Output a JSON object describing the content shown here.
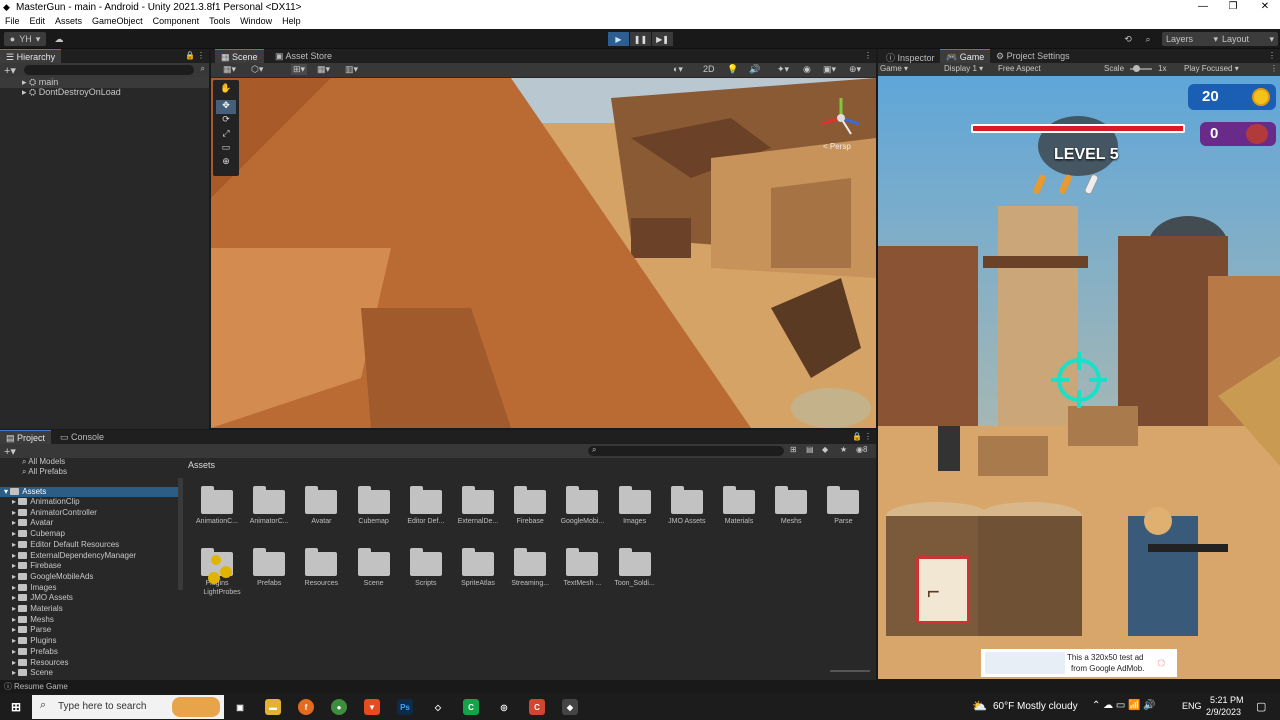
{
  "window": {
    "title": "MasterGun - main - Android - Unity 2021.3.8f1 Personal <DX11>",
    "min_glyph": "—",
    "max_glyph": "❐",
    "close_glyph": "✕"
  },
  "menu": [
    "File",
    "Edit",
    "Assets",
    "GameObject",
    "Component",
    "Tools",
    "Window",
    "Help"
  ],
  "toolbar": {
    "account": "YH",
    "layers": "Layers",
    "layout": "Layout",
    "play_glyph": "▶",
    "pause_glyph": "❚❚",
    "step_glyph": "▶❚"
  },
  "hierarchy": {
    "tab": "Hierarchy",
    "items": [
      "main",
      "DontDestroyOnLoad"
    ]
  },
  "scene": {
    "tabs": [
      "Scene",
      "Asset Store"
    ],
    "mode_2d": "2D",
    "persp": "< Persp"
  },
  "game": {
    "tabs": [
      "Inspector",
      "Game",
      "Project Settings"
    ],
    "display_mode": "Game",
    "display": "Display 1",
    "aspect": "Free Aspect",
    "scale_label": "Scale",
    "scale_value": "1x",
    "play_focused": "Play Focused",
    "hud": {
      "coins": "20",
      "kills": "0",
      "level": "LEVEL 5",
      "health_fraction": 1.0
    },
    "ad": {
      "line1": "This a 320x50 test ad",
      "line2": "from Google AdMob."
    }
  },
  "project": {
    "tabs": [
      "Project",
      "Console"
    ],
    "favorites": [
      "All Models",
      "All Prefabs"
    ],
    "tree_root": "Assets",
    "tree": [
      "AnimationClip",
      "AnimatorController",
      "Avatar",
      "Cubemap",
      "Editor Default Resources",
      "ExternalDependencyManager",
      "Firebase",
      "GoogleMobileAds",
      "Images",
      "JMO Assets",
      "Materials",
      "Meshs",
      "Parse",
      "Plugins",
      "Prefabs",
      "Resources",
      "Scene"
    ],
    "breadcrumb": "Assets",
    "row1": [
      "AnimationC...",
      "AnimatorC...",
      "Avatar",
      "Cubemap",
      "Editor Def...",
      "ExternalDe...",
      "Firebase",
      "GoogleMobi...",
      "Images",
      "JMO Assets",
      "Materials",
      "Meshs",
      "Parse"
    ],
    "row2": [
      "Plugins",
      "Prefabs",
      "Resources",
      "Scene",
      "Scripts",
      "SpriteAtlas",
      "Streaming...",
      "TextMesh ...",
      "Toon_Soldi..."
    ],
    "lightprobes": "LightProbes",
    "badge": "8"
  },
  "status": {
    "text": "Resume Game"
  },
  "taskbar": {
    "search_placeholder": "Type here to search",
    "weather": "60°F  Mostly cloudy",
    "lang": "ENG",
    "time": "5:21 PM",
    "date": "2/9/2023"
  },
  "colors": {
    "play_active": "#2e5e8f",
    "tab_accent": "#4a7ac7",
    "hud_blue": "#1a5fb4",
    "hud_purple": "#6a2a8a",
    "crosshair": "#19e0c8",
    "health": "#d81b2a"
  }
}
